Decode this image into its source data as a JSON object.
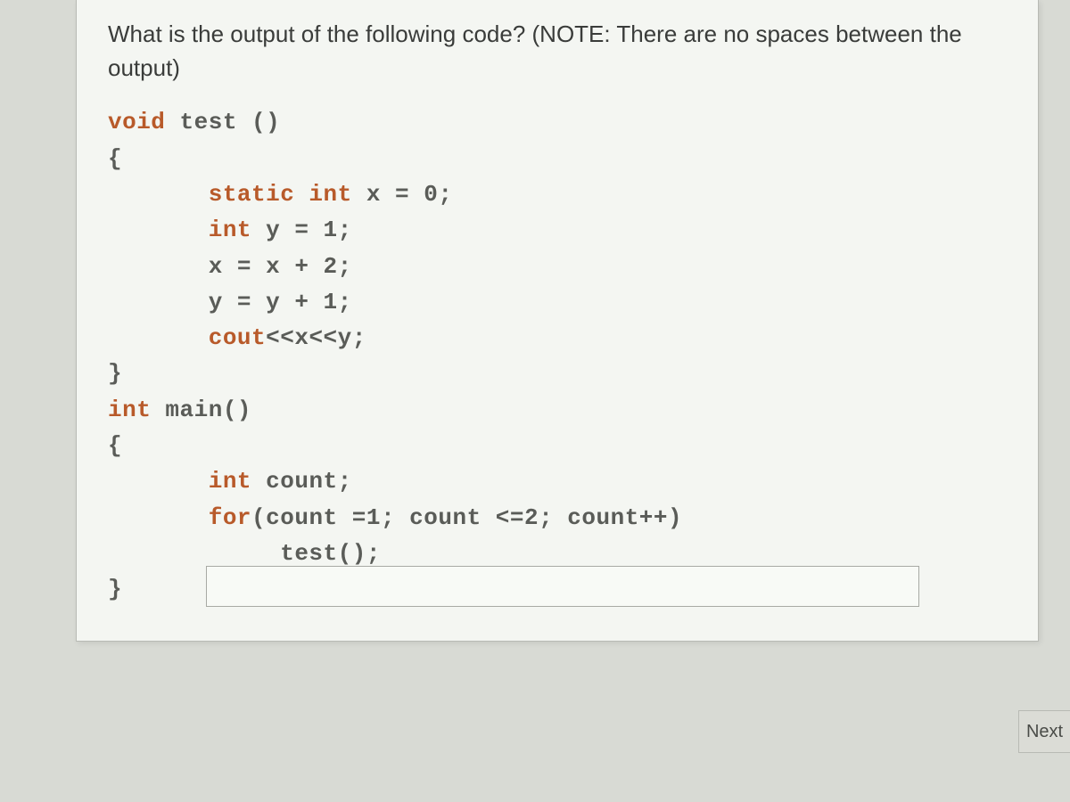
{
  "question": "What is the output of the following code? (NOTE: There are no spaces between the output)",
  "code": {
    "l1_kw": "void",
    "l1_txt": " test ()",
    "l2": "{",
    "l3_kw": "       static int",
    "l3_txt": " x = 0;",
    "l4_kw": "       int",
    "l4_txt": " y = 1;",
    "l5": "       x = x + 2;",
    "l6": "       y = y + 1;",
    "l7_kw": "       cout",
    "l7_txt": "<<x<<y;",
    "l8": "}",
    "l9_kw": "int",
    "l9_txt": " main()",
    "l10": "{",
    "l11_kw": "       int",
    "l11_txt": " count;",
    "l12_kw": "       for",
    "l12_txt": "(count =1; count <=2; count++)",
    "l13": "            test();",
    "l14": "}"
  },
  "answer_placeholder": "",
  "next_label": "Next"
}
